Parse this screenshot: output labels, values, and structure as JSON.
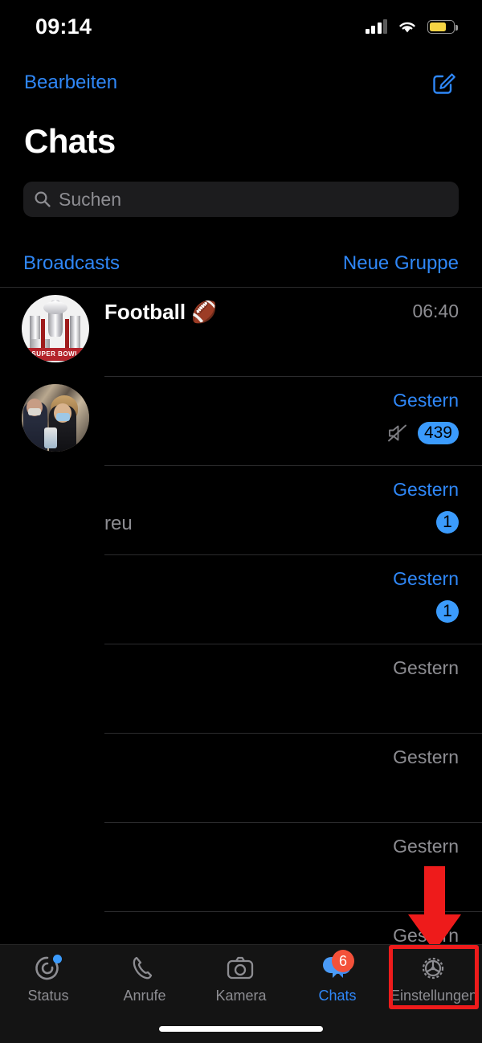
{
  "status_bar": {
    "time": "09:14",
    "cellular_icon": "cellular-signal-icon",
    "wifi_icon": "wifi-icon",
    "battery_icon": "battery-low-power-icon",
    "battery_color": "#f5d444"
  },
  "nav": {
    "edit_label": "Bearbeiten",
    "compose_icon": "compose-new-chat-icon",
    "accent_color": "#2f87f7"
  },
  "header": {
    "title": "Chats"
  },
  "search": {
    "placeholder": "Suchen",
    "icon": "search-icon"
  },
  "broadcast_row": {
    "left_label": "Broadcasts",
    "right_label": "Neue Gruppe"
  },
  "chats": [
    {
      "title": "Football 🏈",
      "snippet": "",
      "time": "06:40",
      "time_unread": false,
      "badge": "",
      "muted": false,
      "avatar": "super-bowl-trophy-avatar"
    },
    {
      "title": "",
      "snippet": "",
      "time": "Gestern",
      "time_unread": true,
      "badge": "439",
      "muted": true,
      "avatar": "photo-people-avatar"
    },
    {
      "title": "",
      "snippet": "reu",
      "time": "Gestern",
      "time_unread": true,
      "badge": "1",
      "muted": false,
      "avatar": ""
    },
    {
      "title": "",
      "snippet": "",
      "time": "Gestern",
      "time_unread": true,
      "badge": "1",
      "muted": false,
      "avatar": ""
    },
    {
      "title": "",
      "snippet": "",
      "time": "Gestern",
      "time_unread": false,
      "badge": "",
      "muted": false,
      "avatar": ""
    },
    {
      "title": "",
      "snippet": "",
      "time": "Gestern",
      "time_unread": false,
      "badge": "",
      "muted": false,
      "avatar": ""
    },
    {
      "title": "",
      "snippet": "",
      "time": "Gestern",
      "time_unread": false,
      "badge": "",
      "muted": false,
      "avatar": ""
    },
    {
      "title": "",
      "snippet": "",
      "time": "Gestern",
      "time_unread": false,
      "badge": "",
      "muted": false,
      "avatar": ""
    }
  ],
  "annotation": {
    "arrow_icon": "red-down-arrow-pointer",
    "arrow_color": "#ee1b1b",
    "highlight_color": "#ee1b1b",
    "points_to": "Einstellungen"
  },
  "tabbar": {
    "items": [
      {
        "label": "Status",
        "icon": "status-rings-icon",
        "active": false,
        "badge": "",
        "dot": true
      },
      {
        "label": "Anrufe",
        "icon": "phone-icon",
        "active": false,
        "badge": "",
        "dot": false
      },
      {
        "label": "Kamera",
        "icon": "camera-icon",
        "active": false,
        "badge": "",
        "dot": false
      },
      {
        "label": "Chats",
        "icon": "chat-bubbles-icon",
        "active": true,
        "badge": "6",
        "dot": false
      },
      {
        "label": "Einstellungen",
        "icon": "gear-icon",
        "active": false,
        "badge": "",
        "dot": false
      }
    ],
    "active_color": "#2f87f7",
    "inactive_color": "#8d8d92",
    "badge_color": "#f4513a"
  }
}
